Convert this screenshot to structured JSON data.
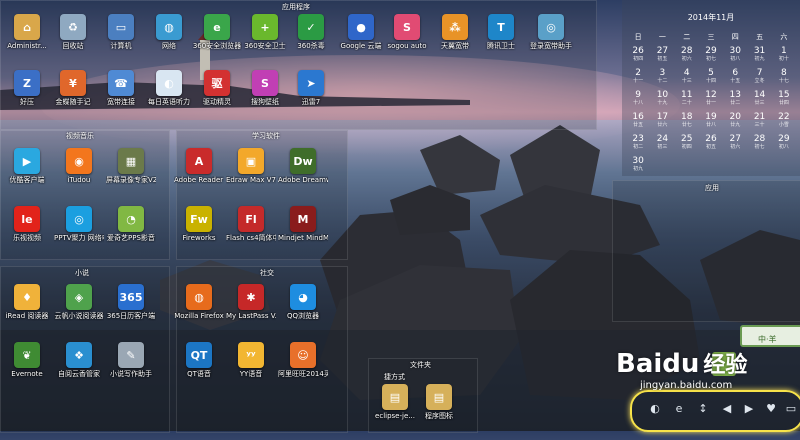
{
  "fences": {
    "apps_top": "应用程序",
    "video_music": "视频音乐",
    "study": "学习软件",
    "novel": "小说",
    "social": "社交",
    "apps_right": "应用",
    "folder": "文件夹",
    "shortcuts": "捷方式"
  },
  "desktop_icons": [
    {
      "label": "Administr...",
      "glyph": "⌂",
      "color": "#d9a74a"
    },
    {
      "label": "回收站",
      "glyph": "♻",
      "color": "#8fa9c1"
    },
    {
      "label": "计算机",
      "glyph": "▭",
      "color": "#4b7fc0"
    },
    {
      "label": "网络",
      "glyph": "◍",
      "color": "#3a9bd1"
    },
    {
      "label": "360安全浏览器",
      "glyph": "e",
      "color": "#3aa64a"
    },
    {
      "label": "360安全卫士",
      "glyph": "+",
      "color": "#6ab82d"
    },
    {
      "label": "360杀毒",
      "glyph": "✓",
      "color": "#2b9b44"
    },
    {
      "label": "Google 云端",
      "glyph": "●",
      "color": "#2f66c9"
    },
    {
      "label": "sogou auto",
      "glyph": "S",
      "color": "#e14b73"
    },
    {
      "label": "天翼宽带",
      "glyph": "⁂",
      "color": "#e89327"
    },
    {
      "label": "腾讯卫士",
      "glyph": "T",
      "color": "#1e86c9"
    },
    {
      "label": "登录宽带助手",
      "glyph": "◎",
      "color": "#5aa0c8"
    },
    {
      "label": "好压",
      "glyph": "Z",
      "color": "#3b6fc6"
    },
    {
      "label": "金蝶随手记",
      "glyph": "¥",
      "color": "#e0672b"
    },
    {
      "label": "宽带连接",
      "glyph": "☎",
      "color": "#4f8ad4"
    },
    {
      "label": "每日英语听力",
      "glyph": "◐",
      "color": "#d9e6f2"
    },
    {
      "label": "驱动精灵",
      "glyph": "驱",
      "color": "#d33131"
    },
    {
      "label": "搜狗壁纸",
      "glyph": "S",
      "color": "#c13fb4"
    },
    {
      "label": "迅雷7",
      "glyph": "➤",
      "color": "#2b78d0"
    }
  ],
  "video_icons": [
    {
      "label": "优酷客户端",
      "glyph": "▶",
      "color": "#2aa8e0"
    },
    {
      "label": "iTudou",
      "glyph": "◉",
      "color": "#f3761d"
    },
    {
      "label": "屏幕录像专家V2014",
      "glyph": "▦",
      "color": "#6b7a4a"
    },
    {
      "label": "乐视视频",
      "glyph": "le",
      "color": "#e2231a"
    },
    {
      "label": "PPTV聚力 网络电视",
      "glyph": "◎",
      "color": "#1b9fe0"
    },
    {
      "label": "爱奇艺PPS影音",
      "glyph": "◔",
      "color": "#81b843"
    }
  ],
  "study_icons": [
    {
      "label": "Adobe Reader XI",
      "glyph": "A",
      "color": "#c92b2b"
    },
    {
      "label": "Edraw Max V7.3",
      "glyph": "▣",
      "color": "#f3a82a"
    },
    {
      "label": "Adobe Dreamwe...",
      "glyph": "Dw",
      "color": "#3f6d2a"
    },
    {
      "label": "Fireworks",
      "glyph": "Fw",
      "color": "#c9b200"
    },
    {
      "label": "Flash cs4简体中文版",
      "glyph": "Fl",
      "color": "#c42a2a"
    },
    {
      "label": "Mindjet MindMan...",
      "glyph": "M",
      "color": "#8a1c1c"
    }
  ],
  "novel_icons": [
    {
      "label": "iRead 阅读器",
      "glyph": "♦",
      "color": "#f0b23a"
    },
    {
      "label": "云帆小说阅读器",
      "glyph": "◈",
      "color": "#4fa24c"
    },
    {
      "label": "365日历客户端",
      "glyph": "365",
      "color": "#2a6fcf"
    },
    {
      "label": "Evernote",
      "glyph": "❦",
      "color": "#3f8b33"
    },
    {
      "label": "自阅云香管家",
      "glyph": "❖",
      "color": "#2a8fd0"
    },
    {
      "label": "小说写作助手",
      "glyph": "✎",
      "color": "#9aa7b4"
    }
  ],
  "social_icons": [
    {
      "label": "Mozilla Firefox",
      "glyph": "◍",
      "color": "#e76b1c"
    },
    {
      "label": "My LastPass V...",
      "glyph": "✱",
      "color": "#c62828"
    },
    {
      "label": "QQ浏览器",
      "glyph": "◕",
      "color": "#1e8de0"
    },
    {
      "label": "QT语音",
      "glyph": "QT",
      "color": "#1c76c4"
    },
    {
      "label": "YY语音",
      "glyph": "ʸʸ",
      "color": "#f2b632"
    },
    {
      "label": "阿里旺旺2014买家版",
      "glyph": "☺",
      "color": "#e8702a"
    }
  ],
  "folder_icons": [
    {
      "label": "eclipse-je...",
      "glyph": "▤",
      "color": "#d6b05a"
    },
    {
      "label": "程序图标",
      "glyph": "▤",
      "color": "#d6b05a"
    }
  ],
  "calendar": {
    "title": "2014年11月",
    "weekdays": [
      "日",
      "一",
      "二",
      "三",
      "四",
      "五",
      "六"
    ],
    "days": [
      {
        "d": "26",
        "l": "初四"
      },
      {
        "d": "27",
        "l": "初五"
      },
      {
        "d": "28",
        "l": "初六"
      },
      {
        "d": "29",
        "l": "初七"
      },
      {
        "d": "30",
        "l": "初八"
      },
      {
        "d": "31",
        "l": "初九"
      },
      {
        "d": "1",
        "l": "初十"
      },
      {
        "d": "2",
        "l": "十一"
      },
      {
        "d": "3",
        "l": "十二"
      },
      {
        "d": "4",
        "l": "十三"
      },
      {
        "d": "5",
        "l": "十四"
      },
      {
        "d": "6",
        "l": "十五"
      },
      {
        "d": "7",
        "l": "立冬"
      },
      {
        "d": "8",
        "l": "十七"
      },
      {
        "d": "9",
        "l": "十八"
      },
      {
        "d": "10",
        "l": "十九"
      },
      {
        "d": "11",
        "l": "二十"
      },
      {
        "d": "12",
        "l": "廿一"
      },
      {
        "d": "13",
        "l": "廿二"
      },
      {
        "d": "14",
        "l": "廿三"
      },
      {
        "d": "15",
        "l": "廿四"
      },
      {
        "d": "16",
        "l": "廿五"
      },
      {
        "d": "17",
        "l": "廿六"
      },
      {
        "d": "18",
        "l": "廿七"
      },
      {
        "d": "19",
        "l": "廿八"
      },
      {
        "d": "20",
        "l": "廿九"
      },
      {
        "d": "21",
        "l": "三十"
      },
      {
        "d": "22",
        "l": "小雪"
      },
      {
        "d": "23",
        "l": "初二"
      },
      {
        "d": "24",
        "l": "初三"
      },
      {
        "d": "25",
        "l": "初四"
      },
      {
        "d": "26",
        "l": "初五"
      },
      {
        "d": "27",
        "l": "初六"
      },
      {
        "d": "28",
        "l": "初七"
      },
      {
        "d": "29",
        "l": "初八"
      },
      {
        "d": "30",
        "l": "初九"
      }
    ]
  },
  "widget_text": "中·羊",
  "watermark": {
    "brand": "Baidu",
    "brand2": "经验",
    "site": "jingyan.baidu.com"
  },
  "taskbar_icons": [
    "◐",
    "e",
    "↕",
    "◀",
    "▶",
    "♥",
    "▭"
  ]
}
